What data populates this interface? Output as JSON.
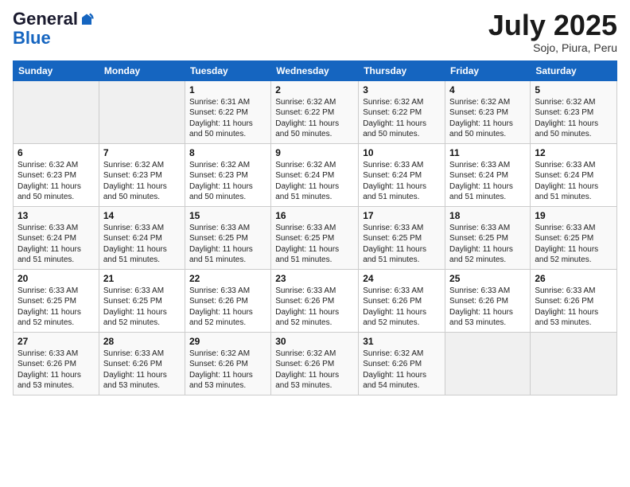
{
  "header": {
    "logo_general": "General",
    "logo_blue": "Blue",
    "month": "July 2025",
    "location": "Sojo, Piura, Peru"
  },
  "weekdays": [
    "Sunday",
    "Monday",
    "Tuesday",
    "Wednesday",
    "Thursday",
    "Friday",
    "Saturday"
  ],
  "weeks": [
    [
      {
        "day": "",
        "info": ""
      },
      {
        "day": "",
        "info": ""
      },
      {
        "day": "1",
        "info": "Sunrise: 6:31 AM\nSunset: 6:22 PM\nDaylight: 11 hours and 50 minutes."
      },
      {
        "day": "2",
        "info": "Sunrise: 6:32 AM\nSunset: 6:22 PM\nDaylight: 11 hours and 50 minutes."
      },
      {
        "day": "3",
        "info": "Sunrise: 6:32 AM\nSunset: 6:22 PM\nDaylight: 11 hours and 50 minutes."
      },
      {
        "day": "4",
        "info": "Sunrise: 6:32 AM\nSunset: 6:23 PM\nDaylight: 11 hours and 50 minutes."
      },
      {
        "day": "5",
        "info": "Sunrise: 6:32 AM\nSunset: 6:23 PM\nDaylight: 11 hours and 50 minutes."
      }
    ],
    [
      {
        "day": "6",
        "info": "Sunrise: 6:32 AM\nSunset: 6:23 PM\nDaylight: 11 hours and 50 minutes."
      },
      {
        "day": "7",
        "info": "Sunrise: 6:32 AM\nSunset: 6:23 PM\nDaylight: 11 hours and 50 minutes."
      },
      {
        "day": "8",
        "info": "Sunrise: 6:32 AM\nSunset: 6:23 PM\nDaylight: 11 hours and 50 minutes."
      },
      {
        "day": "9",
        "info": "Sunrise: 6:32 AM\nSunset: 6:24 PM\nDaylight: 11 hours and 51 minutes."
      },
      {
        "day": "10",
        "info": "Sunrise: 6:33 AM\nSunset: 6:24 PM\nDaylight: 11 hours and 51 minutes."
      },
      {
        "day": "11",
        "info": "Sunrise: 6:33 AM\nSunset: 6:24 PM\nDaylight: 11 hours and 51 minutes."
      },
      {
        "day": "12",
        "info": "Sunrise: 6:33 AM\nSunset: 6:24 PM\nDaylight: 11 hours and 51 minutes."
      }
    ],
    [
      {
        "day": "13",
        "info": "Sunrise: 6:33 AM\nSunset: 6:24 PM\nDaylight: 11 hours and 51 minutes."
      },
      {
        "day": "14",
        "info": "Sunrise: 6:33 AM\nSunset: 6:24 PM\nDaylight: 11 hours and 51 minutes."
      },
      {
        "day": "15",
        "info": "Sunrise: 6:33 AM\nSunset: 6:25 PM\nDaylight: 11 hours and 51 minutes."
      },
      {
        "day": "16",
        "info": "Sunrise: 6:33 AM\nSunset: 6:25 PM\nDaylight: 11 hours and 51 minutes."
      },
      {
        "day": "17",
        "info": "Sunrise: 6:33 AM\nSunset: 6:25 PM\nDaylight: 11 hours and 51 minutes."
      },
      {
        "day": "18",
        "info": "Sunrise: 6:33 AM\nSunset: 6:25 PM\nDaylight: 11 hours and 52 minutes."
      },
      {
        "day": "19",
        "info": "Sunrise: 6:33 AM\nSunset: 6:25 PM\nDaylight: 11 hours and 52 minutes."
      }
    ],
    [
      {
        "day": "20",
        "info": "Sunrise: 6:33 AM\nSunset: 6:25 PM\nDaylight: 11 hours and 52 minutes."
      },
      {
        "day": "21",
        "info": "Sunrise: 6:33 AM\nSunset: 6:25 PM\nDaylight: 11 hours and 52 minutes."
      },
      {
        "day": "22",
        "info": "Sunrise: 6:33 AM\nSunset: 6:26 PM\nDaylight: 11 hours and 52 minutes."
      },
      {
        "day": "23",
        "info": "Sunrise: 6:33 AM\nSunset: 6:26 PM\nDaylight: 11 hours and 52 minutes."
      },
      {
        "day": "24",
        "info": "Sunrise: 6:33 AM\nSunset: 6:26 PM\nDaylight: 11 hours and 52 minutes."
      },
      {
        "day": "25",
        "info": "Sunrise: 6:33 AM\nSunset: 6:26 PM\nDaylight: 11 hours and 53 minutes."
      },
      {
        "day": "26",
        "info": "Sunrise: 6:33 AM\nSunset: 6:26 PM\nDaylight: 11 hours and 53 minutes."
      }
    ],
    [
      {
        "day": "27",
        "info": "Sunrise: 6:33 AM\nSunset: 6:26 PM\nDaylight: 11 hours and 53 minutes."
      },
      {
        "day": "28",
        "info": "Sunrise: 6:33 AM\nSunset: 6:26 PM\nDaylight: 11 hours and 53 minutes."
      },
      {
        "day": "29",
        "info": "Sunrise: 6:32 AM\nSunset: 6:26 PM\nDaylight: 11 hours and 53 minutes."
      },
      {
        "day": "30",
        "info": "Sunrise: 6:32 AM\nSunset: 6:26 PM\nDaylight: 11 hours and 53 minutes."
      },
      {
        "day": "31",
        "info": "Sunrise: 6:32 AM\nSunset: 6:26 PM\nDaylight: 11 hours and 54 minutes."
      },
      {
        "day": "",
        "info": ""
      },
      {
        "day": "",
        "info": ""
      }
    ]
  ]
}
